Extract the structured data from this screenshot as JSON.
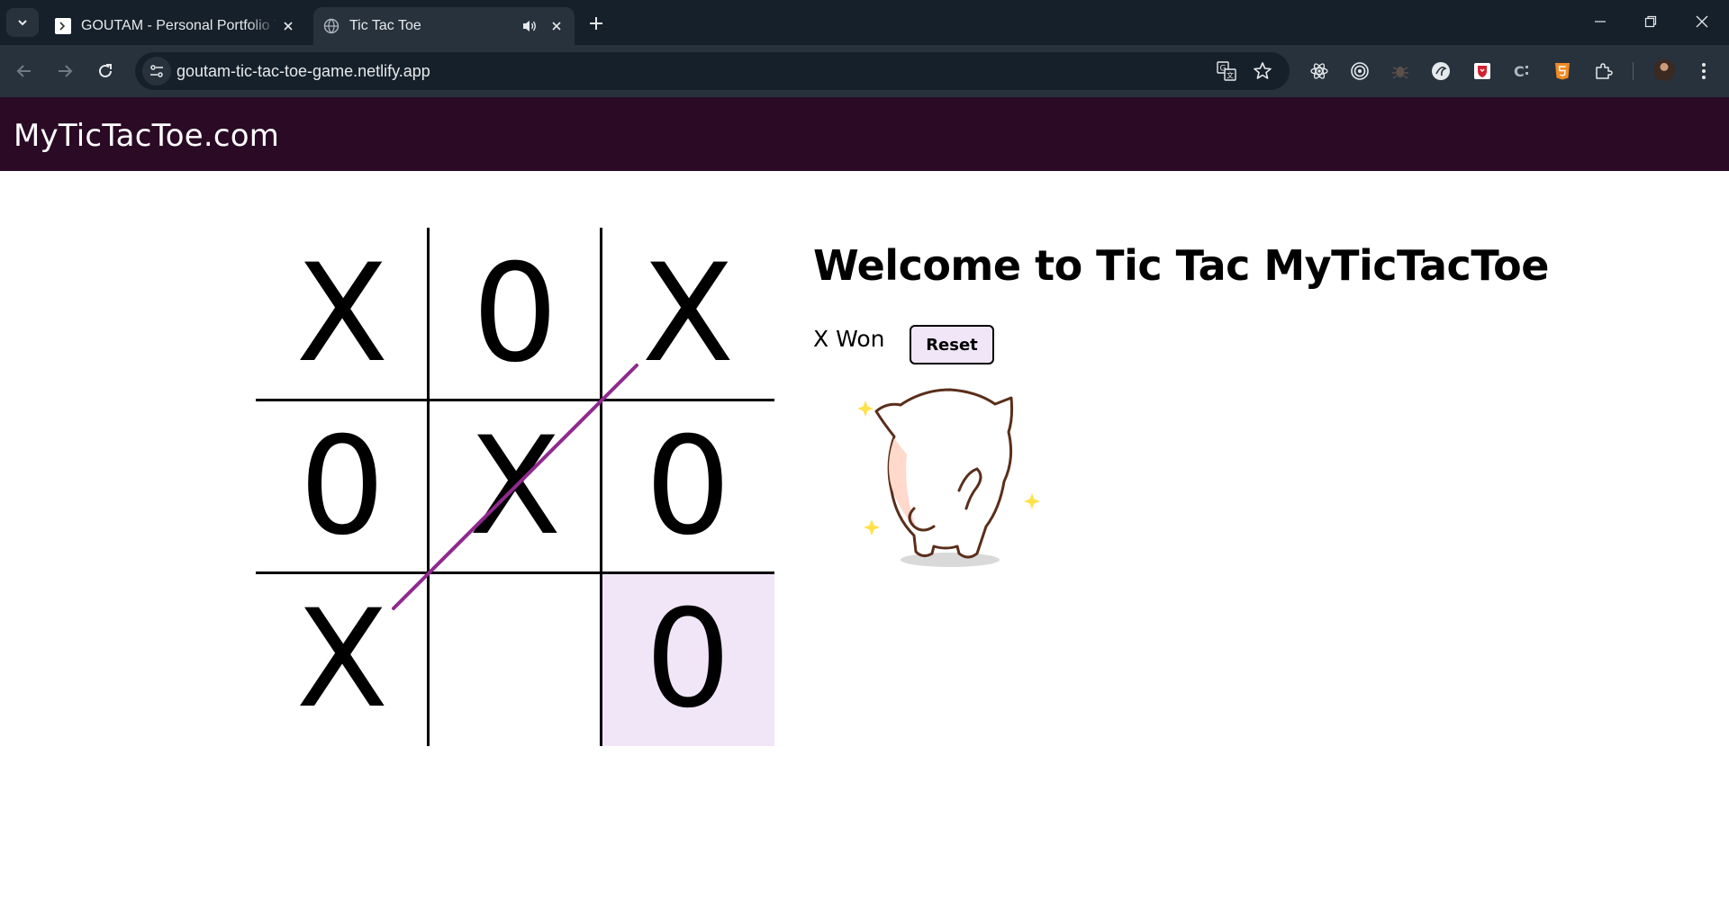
{
  "browser": {
    "tabs": [
      {
        "title": "GOUTAM - Personal Portfolio Te",
        "active": false
      },
      {
        "title": "Tic Tac Toe",
        "active": true
      }
    ],
    "url": "goutam-tic-tac-toe-game.netlify.app"
  },
  "site": {
    "brand": "MyTicTacToe.com"
  },
  "game": {
    "cells": [
      "X",
      "0",
      "X",
      "0",
      "X",
      "0",
      "X",
      "",
      "0"
    ],
    "highlighted_cell": 8,
    "winning_line": [
      2,
      4,
      6
    ],
    "winner": "X"
  },
  "panel": {
    "welcome": "Welcome to Tic Tac MyTicTacToe",
    "status": "X Won",
    "reset_label": "Reset"
  },
  "colors": {
    "header_bg": "#2a0a25",
    "win_line": "#8e2a8e",
    "cell_highlight": "#f1e6f7"
  }
}
